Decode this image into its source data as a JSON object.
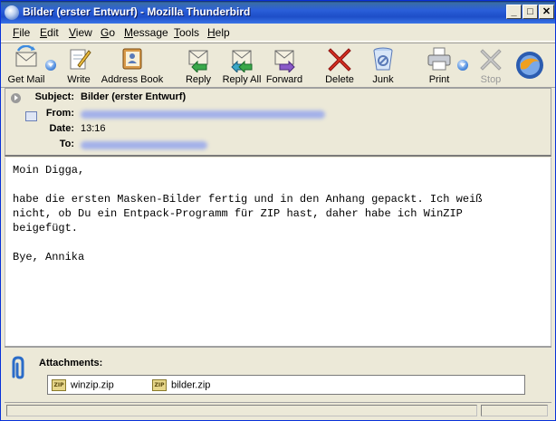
{
  "window": {
    "title": "Bilder (erster Entwurf) - Mozilla Thunderbird",
    "minimize_label": "_",
    "maximize_label": "□",
    "close_label": "✕"
  },
  "menu": {
    "items": [
      {
        "ul": "F",
        "rest": "ile"
      },
      {
        "ul": "E",
        "rest": "dit"
      },
      {
        "ul": "V",
        "rest": "iew"
      },
      {
        "ul": "G",
        "rest": "o"
      },
      {
        "ul": "M",
        "rest": "essage"
      },
      {
        "ul": "T",
        "rest": "ools"
      },
      {
        "ul": "H",
        "rest": "elp"
      }
    ]
  },
  "toolbar": {
    "get_mail": "Get Mail",
    "write": "Write",
    "address_book": "Address Book",
    "reply": "Reply",
    "reply_all": "Reply All",
    "forward": "Forward",
    "delete": "Delete",
    "junk": "Junk",
    "print": "Print",
    "stop": "Stop"
  },
  "header": {
    "subject_label": "Subject:",
    "subject": "Bilder (erster Entwurf)",
    "from_label": "From:",
    "date_label": "Date:",
    "date": "13:16",
    "to_label": "To:"
  },
  "body": {
    "text": "Moin Digga,\n\nhabe die ersten Masken-Bilder fertig und in den Anhang gepackt. Ich weiß\nnicht, ob Du ein Entpack-Programm für ZIP hast, daher habe ich WinZIP\nbeigefügt.\n\nBye, Annika"
  },
  "attachments": {
    "label": "Attachments:",
    "icon_text": "ZIP",
    "files": [
      {
        "name": "winzip.zip"
      },
      {
        "name": "bilder.zip"
      }
    ]
  },
  "colors": {
    "titlebar": "#2b5fd9",
    "window_bg": "#ece9d8",
    "redacted": "#8a9ef0"
  }
}
